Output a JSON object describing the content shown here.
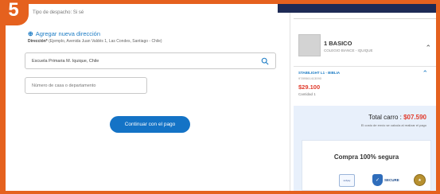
{
  "step": {
    "number": "5"
  },
  "checkout": {
    "dispatch_label": "Tipo de despacho: Si sé",
    "add_address_label": "Agregar nueva dirección",
    "address_hint_prefix": "Dirección*",
    "address_hint_text": "(Ejemplo, Avenida Juan Valdés 1, Las Condes, Santiago - Chile)",
    "search_input_value": "Escuela Primaria M. Iquique, Chile",
    "house_input_placeholder": "Número de casa o departamento",
    "continue_button_label": "Continuar con el pago"
  },
  "cart": {
    "product_title": "1 BASICO",
    "product_subtitle": "COLEGIO BIANCE - IQUIQUE",
    "item_name": "STABILIGHT L1 - BIBLIA",
    "item_code": "9789561413090",
    "item_price": "$29.100",
    "item_quantity": "Cantidad 1",
    "total_label": "Total carro : ",
    "total_amount": "$07.590",
    "total_note": "El costo de envío se calcula al realizar el pago",
    "secure_title": "Compra 100% segura"
  },
  "badges": {
    "webpay": "webpay",
    "ssl": "SECURE"
  },
  "colors": {
    "frame": "#e5611e",
    "accent_blue": "#1473c6",
    "price_red": "#e03a2b",
    "summary_bg": "#e8f0fb",
    "header_dark": "#1d2a55"
  },
  "icons": {
    "search": "search-icon",
    "chevron": "chevron-up-icon",
    "plus": "plus-icon",
    "shield": "shield-icon",
    "seal": "seal-icon"
  }
}
